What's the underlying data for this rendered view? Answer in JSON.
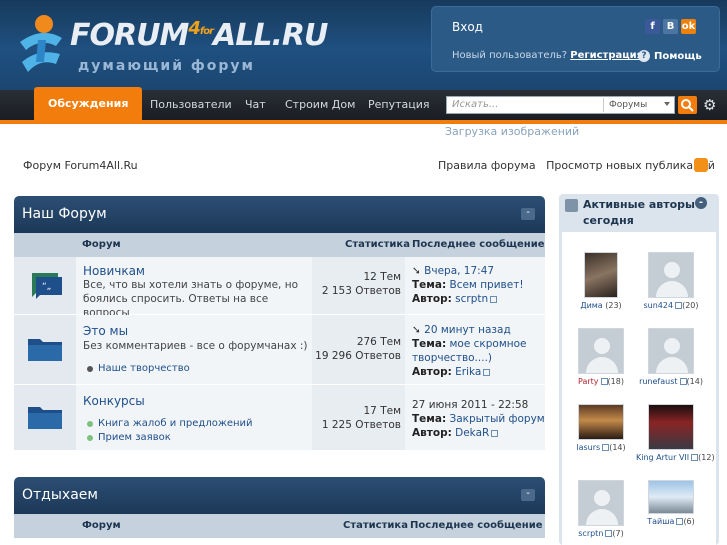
{
  "header": {
    "logo_main": "FORUM",
    "logo_4": "4",
    "logo_for": "for",
    "logo_tail": "ALL.RU",
    "logo_sub": "думающий форум",
    "login_title": "Вход",
    "new_user": "Новый пользователь?",
    "register": "Регистрация",
    "help": "Помощь",
    "socials": [
      {
        "name": "facebook",
        "letter": "f",
        "color": "#3b5998"
      },
      {
        "name": "vkontakte",
        "letter": "В",
        "color": "#4c75a3"
      },
      {
        "name": "odnoklassniki",
        "letter": "ok",
        "color": "#ee8208"
      }
    ]
  },
  "nav": {
    "tabs": [
      "Обсуждения",
      "Пользователи",
      "Чат",
      "Строим Дом",
      "Репутация"
    ],
    "search_placeholder": "Искать...",
    "search_scope": "Форумы",
    "upload": "Загрузка изображений"
  },
  "breadcrumb": "Форум Forum4All.Ru",
  "links": {
    "rules": "Правила форума",
    "new_posts": "Просмотр новых публикаций"
  },
  "columns": {
    "forum": "Форум",
    "stats": "Статистика",
    "last": "Последнее сообщение"
  },
  "categories": [
    {
      "title": "Наш Форум",
      "forums": [
        {
          "name": "Новичкам",
          "desc": "Все, что вы хотели знать о форуме, но боялись спросить. Ответы на все вопросы",
          "topics": "12 Тем",
          "replies": "2 153 Ответов",
          "last_date": "Вчера, 17:47",
          "topic_label": "Тема:",
          "topic": "Всем привет!",
          "author_label": "Автор:",
          "author": "scrptn",
          "subforums": []
        },
        {
          "name": "Это мы",
          "desc": "Без комментариев - все о форумчанах :)",
          "topics": "276 Тем",
          "replies": "19 296 Ответов",
          "last_date": "20 минут назад",
          "topic_label": "Тема:",
          "topic": "мое скромное творчество....)",
          "author_label": "Автор:",
          "author": "Erika",
          "subforums": [
            "Наше творчество"
          ]
        },
        {
          "name": "Конкурсы",
          "desc": "",
          "topics": "17 Тем",
          "replies": "1 225 Ответов",
          "last_date": "27 июня 2011 - 22:58",
          "topic_label": "Тема:",
          "topic": "Закрытый форум",
          "author_label": "Автор:",
          "author": "DekaR",
          "subforums": [
            "Книга жалоб и предложений",
            "Прием заявок"
          ]
        }
      ]
    },
    {
      "title": "Отдыхаем",
      "forums": []
    }
  ],
  "sidebar": {
    "title": "Активные авторы сегодня",
    "users": [
      {
        "name": "Дима",
        "count": "(23)",
        "color": "#1f4f8a"
      },
      {
        "name": "sun424",
        "count": "(20)",
        "color": "#1f4f8a"
      },
      {
        "name": "Party",
        "count": "(18)",
        "color": "#b0292e"
      },
      {
        "name": "runefaust",
        "count": "(14)",
        "color": "#1f4f8a"
      },
      {
        "name": "lasurs",
        "count": "(14)",
        "color": "#1f4f8a"
      },
      {
        "name": "King Artur VII",
        "count": "(12)",
        "color": "#1f4f8a"
      },
      {
        "name": "scrptn",
        "count": "(7)",
        "color": "#1f4f8a"
      },
      {
        "name": "Тайша",
        "count": "(6)",
        "color": "#1f4f8a"
      }
    ]
  }
}
